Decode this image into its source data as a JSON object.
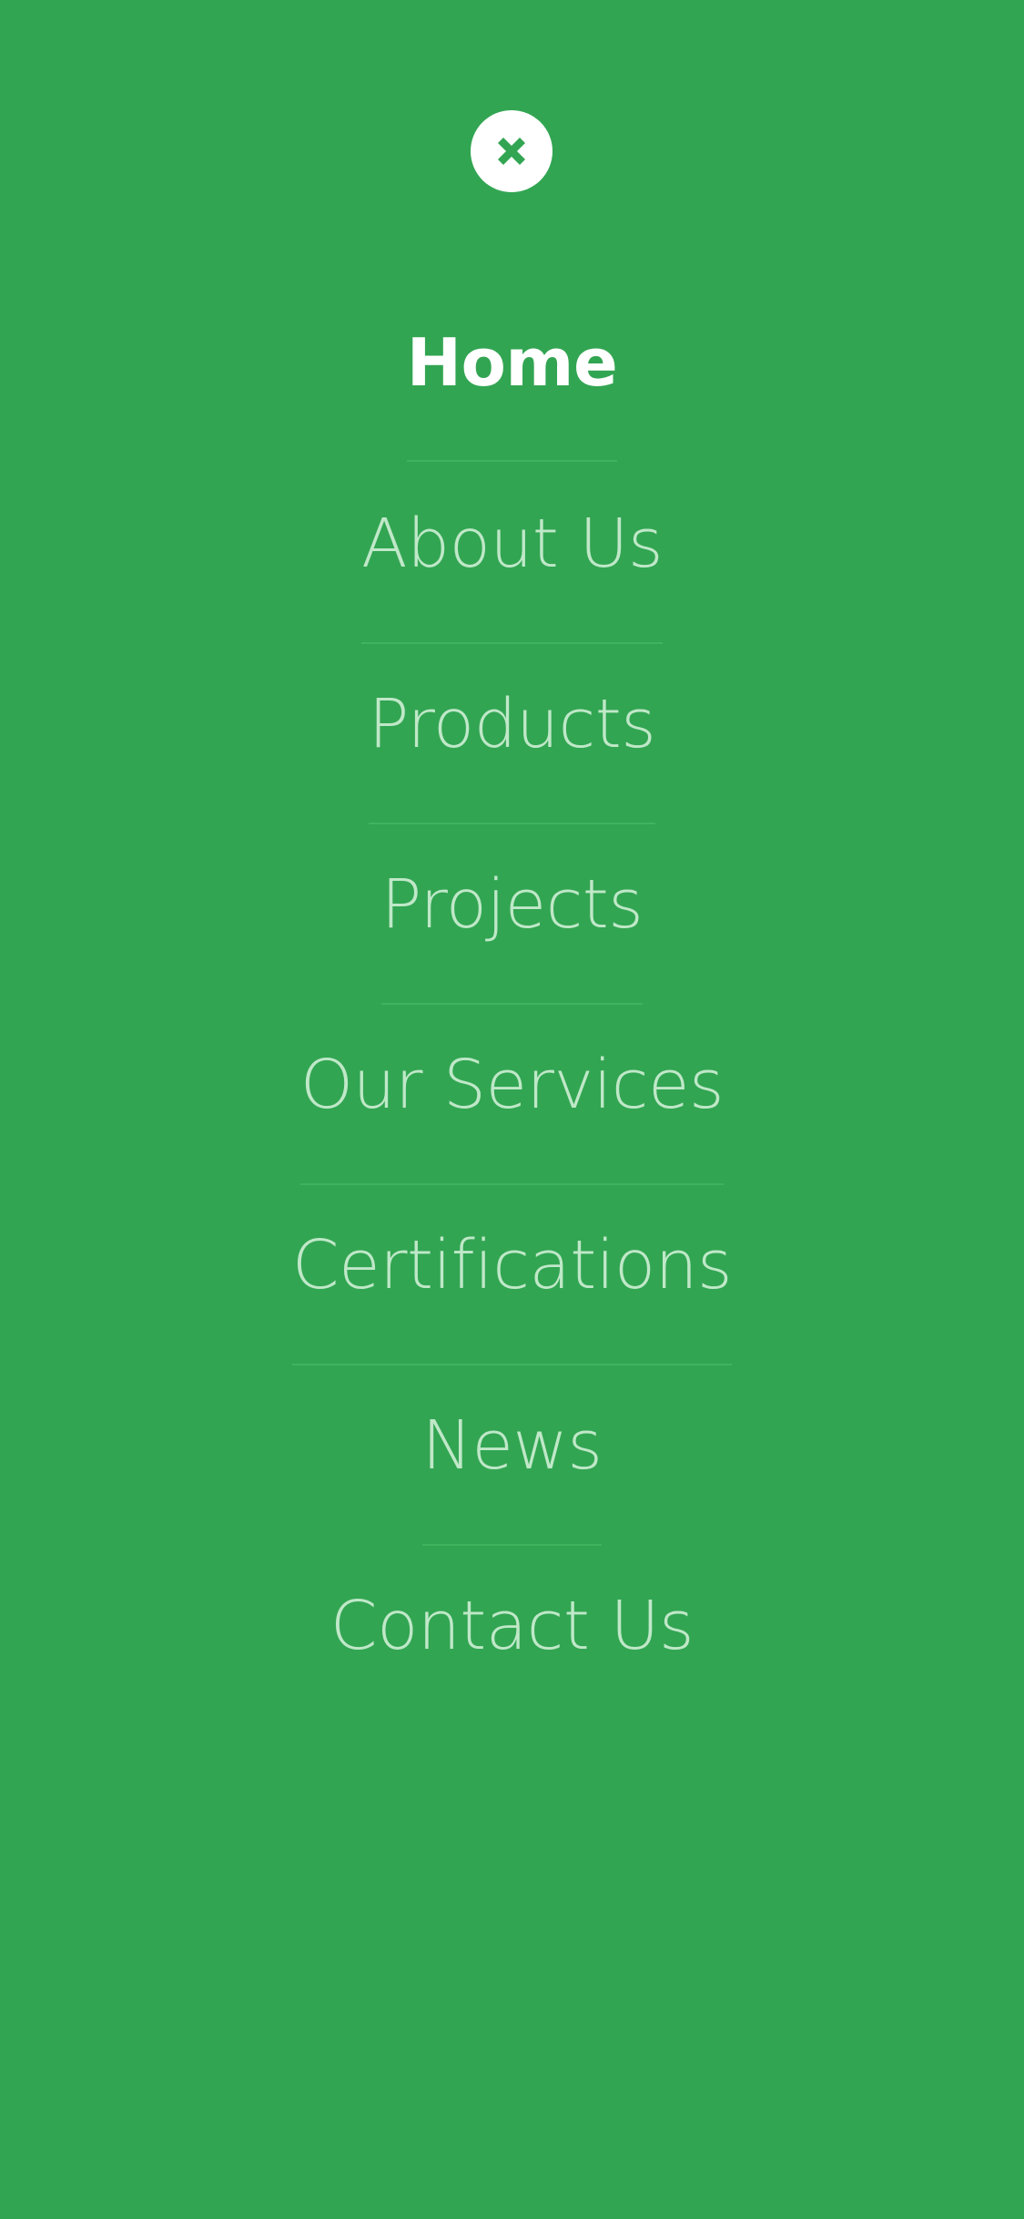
{
  "colors": {
    "background": "#32a552",
    "close_button_bg": "#ffffff",
    "close_icon": "#32a552",
    "menu_text": "#bfe8c8",
    "menu_active_text": "#ffffff",
    "divider": "#40b35f"
  },
  "close_button": {
    "icon": "close-icon"
  },
  "menu": {
    "items": [
      {
        "label": "Home",
        "active": true
      },
      {
        "label": "About Us",
        "active": false
      },
      {
        "label": "Products",
        "active": false
      },
      {
        "label": "Projects",
        "active": false
      },
      {
        "label": "Our Services",
        "active": false
      },
      {
        "label": "Certifications",
        "active": false
      },
      {
        "label": "News",
        "active": false
      },
      {
        "label": "Contact Us",
        "active": false
      }
    ]
  }
}
